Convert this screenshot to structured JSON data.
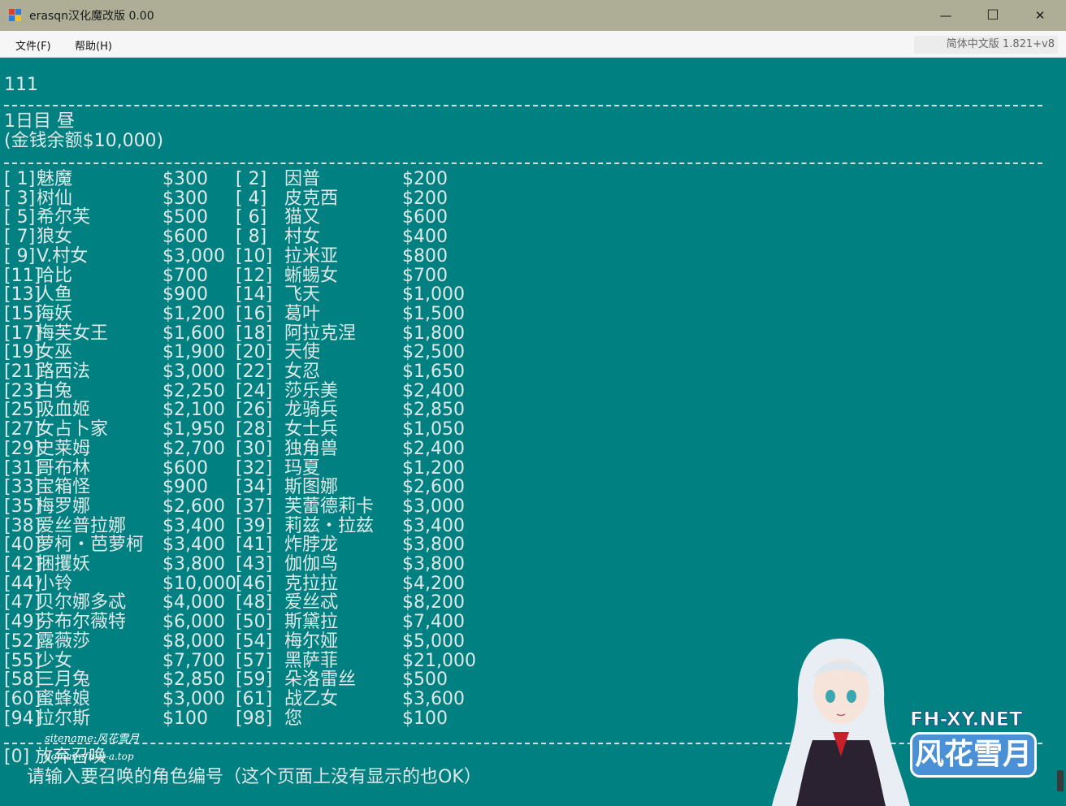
{
  "window": {
    "title": "erasqn汉化魔改版 0.00",
    "minimize_glyph": "—",
    "maximize_glyph": "☐",
    "close_glyph": "✕"
  },
  "menu": {
    "file": "文件(F)",
    "help": "帮助(H)",
    "version": "简体中文版 1.821+v8"
  },
  "console": {
    "line1": "111",
    "date": "1日目 昼",
    "money": "(金钱余额$10,000)",
    "rows": [
      [
        [
          "[ 1]",
          "魅魔",
          "$300"
        ],
        [
          "[ 2]",
          "因普",
          "$200"
        ]
      ],
      [
        [
          "[ 3]",
          "树仙",
          "$300"
        ],
        [
          "[ 4]",
          "皮克西",
          "$200"
        ]
      ],
      [
        [
          "[ 5]",
          "希尔芙",
          "$500"
        ],
        [
          "[ 6]",
          "猫又",
          "$600"
        ]
      ],
      [
        [
          "[ 7]",
          "狼女",
          "$600"
        ],
        [
          "[ 8]",
          "村女",
          "$400"
        ]
      ],
      [
        [
          "[ 9]",
          "V.村女",
          "$3,000"
        ],
        [
          "[10]",
          "拉米亚",
          "$800"
        ]
      ],
      [
        [
          "[11]",
          "哈比",
          "$700"
        ],
        [
          "[12]",
          "蜥蜴女",
          "$700"
        ]
      ],
      [
        [
          "[13]",
          "人鱼",
          "$900"
        ],
        [
          "[14]",
          "飞天",
          "$1,000"
        ]
      ],
      [
        [
          "[15]",
          "海妖",
          "$1,200"
        ],
        [
          "[16]",
          "葛叶",
          "$1,500"
        ]
      ],
      [
        [
          "[17]",
          "梅芙女王",
          "$1,600"
        ],
        [
          "[18]",
          "阿拉克涅",
          "$1,800"
        ]
      ],
      [
        [
          "[19]",
          "女巫",
          "$1,900"
        ],
        [
          "[20]",
          "天使",
          "$2,500"
        ]
      ],
      [
        [
          "[21]",
          "路西法",
          "$3,000"
        ],
        [
          "[22]",
          "女忍",
          "$1,650"
        ]
      ],
      [
        [
          "[23]",
          "白兔",
          "$2,250"
        ],
        [
          "[24]",
          "莎乐美",
          "$2,400"
        ]
      ],
      [
        [
          "[25]",
          "吸血姬",
          "$2,100"
        ],
        [
          "[26]",
          "龙骑兵",
          "$2,850"
        ]
      ],
      [
        [
          "[27]",
          "女占卜家",
          "$1,950"
        ],
        [
          "[28]",
          "女士兵",
          "$1,050"
        ]
      ],
      [
        [
          "[29]",
          "史莱姆",
          "$2,700"
        ],
        [
          "[30]",
          "独角兽",
          "$2,400"
        ]
      ],
      [
        [
          "[31]",
          "哥布林",
          "$600"
        ],
        [
          "[32]",
          "玛夏",
          "$1,200"
        ]
      ],
      [
        [
          "[33]",
          "宝箱怪",
          "$900"
        ],
        [
          "[34]",
          "斯图娜",
          "$2,600"
        ]
      ],
      [
        [
          "[35]",
          "梅罗娜",
          "$2,600"
        ],
        [
          "[37]",
          "芙蕾德莉卡",
          "$3,000"
        ]
      ],
      [
        [
          "[38]",
          "爱丝普拉娜",
          "$3,400"
        ],
        [
          "[39]",
          "莉兹・拉兹",
          "$3,400"
        ]
      ],
      [
        [
          "[40]",
          "萝柯・芭萝柯",
          "$3,400"
        ],
        [
          "[41]",
          "炸脖龙",
          "$3,800"
        ]
      ],
      [
        [
          "[42]",
          "捆攫妖",
          "$3,800"
        ],
        [
          "[43]",
          "伽伽鸟",
          "$3,800"
        ]
      ],
      [
        [
          "[44]",
          "小铃",
          "$10,000"
        ],
        [
          "[46]",
          "克拉拉",
          "$4,200"
        ]
      ],
      [
        [
          "[47]",
          "贝尔娜多忒",
          "$4,000"
        ],
        [
          "[48]",
          "爱丝忒",
          "$8,200"
        ]
      ],
      [
        [
          "[49]",
          "芬布尔薇特",
          "$6,000"
        ],
        [
          "[50]",
          "斯黛拉",
          "$7,400"
        ]
      ],
      [
        [
          "[52]",
          "露薇莎",
          "$8,000"
        ],
        [
          "[54]",
          "梅尔娅",
          "$5,000"
        ]
      ],
      [
        [
          "[55]",
          "少女",
          "$7,700"
        ],
        [
          "[57]",
          "黑萨菲",
          "$21,000"
        ]
      ],
      [
        [
          "[58]",
          "三月兔",
          "$2,850"
        ],
        [
          "[59]",
          "朵洛雷丝",
          "$500"
        ]
      ],
      [
        [
          "[60]",
          "蜜蜂娘",
          "$3,000"
        ],
        [
          "[61]",
          "战乙女",
          "$3,600"
        ]
      ],
      [
        [
          "[94]",
          "拉尔斯",
          "$100"
        ],
        [
          "[98]",
          "您",
          "$100"
        ]
      ]
    ],
    "abandon": "[0] 放弃召唤",
    "prompt": "请输入要召唤的角色编号（这个页面上没有显示的也OK）"
  },
  "watermark": {
    "sitename": "sitename:风花雪月",
    "domain": "domain:fhxy-a.top",
    "brand_en": "FH-XY.NET",
    "brand_cn": "风花雪月"
  },
  "colors": {
    "console_bg": "#008080",
    "console_text": "#dfe8e8",
    "titlebar": "#aeae96"
  }
}
